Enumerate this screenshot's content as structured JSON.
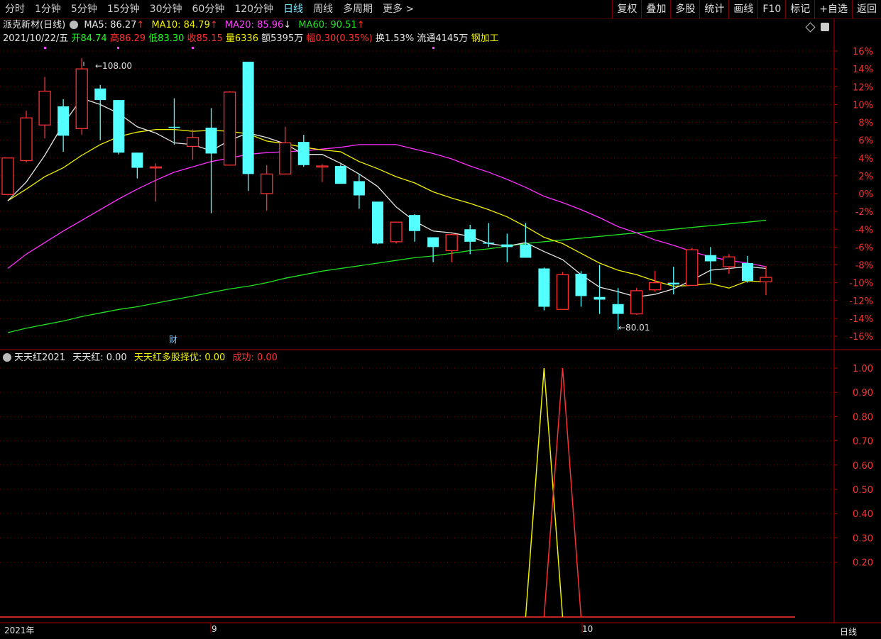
{
  "toolbar": {
    "periods": [
      "分时",
      "1分钟",
      "5分钟",
      "15分钟",
      "30分钟",
      "60分钟",
      "120分钟",
      "日线",
      "周线",
      "多周期",
      "更多 >"
    ],
    "active_period": "日线",
    "buttons": [
      "复权",
      "叠加",
      "多股",
      "统计",
      "画线",
      "F10",
      "标记",
      "+自选",
      "返回"
    ]
  },
  "main_info": {
    "stock_name": "派克新材",
    "period_tag": "(日线)",
    "ma5_label": "MA5: 86.27",
    "ma10_label": "MA10: 84.79",
    "ma20_label": "MA20: 85.96",
    "ma60_label": "MA60: 90.51",
    "date": "2021/10/22/五",
    "open": "开84.74",
    "high": "高86.29",
    "low": "低83.30",
    "close": "收85.15",
    "volume": "量6336",
    "amount": "额5395万",
    "change": "幅0.30(0.35%)",
    "turnover": "换1.53%",
    "float_cap": "流通4145万",
    "industry": "钢加工",
    "high_marker": "108.00",
    "low_marker": "80.01",
    "fin_marker": "财"
  },
  "indicator_info": {
    "name": "天天红2021",
    "line1_label": "天天红: 0.00",
    "line2_label": "天天红多股择优: 0.00",
    "line3_label": "成功: 0.00"
  },
  "x_labels": [
    "2021年",
    "9",
    "10",
    "日线"
  ],
  "colors": {
    "up": "#ff3030",
    "down": "#54ffff",
    "ma5": "#e6e6e6",
    "ma10": "#f0f000",
    "ma20": "#ff30ff",
    "ma60": "#20e020",
    "grid": "#7a0000"
  },
  "chart_data": [
    {
      "type": "candlestick",
      "y_axis": "percent",
      "ylim": [
        -17,
        17
      ],
      "y_ticks": [
        "16%",
        "14%",
        "12%",
        "10%",
        "8%",
        "6%",
        "4%",
        "2%",
        "0%",
        "-2%",
        "-4%",
        "-6%",
        "-8%",
        "-10%",
        "-12%",
        "-14%",
        "-16%"
      ],
      "candles": [
        {
          "o": -0.1,
          "h": 2.9,
          "l": -0.2,
          "c": 4.0,
          "dir": "up"
        },
        {
          "o": 3.7,
          "h": 9.3,
          "l": 3.5,
          "c": 8.5,
          "dir": "up"
        },
        {
          "o": 7.7,
          "h": 13.1,
          "l": 6.2,
          "c": 11.5,
          "dir": "up"
        },
        {
          "o": 9.8,
          "h": 10.6,
          "l": 4.7,
          "c": 6.5,
          "dir": "down"
        },
        {
          "o": 7.3,
          "h": 15.2,
          "l": 6.6,
          "c": 14.0,
          "dir": "up"
        },
        {
          "o": 11.8,
          "h": 12.2,
          "l": 6.0,
          "c": 10.5,
          "dir": "down"
        },
        {
          "o": 10.5,
          "h": 10.5,
          "l": 4.4,
          "c": 4.6,
          "dir": "down"
        },
        {
          "o": 4.6,
          "h": 4.6,
          "l": 1.7,
          "c": 2.9,
          "dir": "down"
        },
        {
          "o": 3.0,
          "h": 3.4,
          "l": -0.9,
          "c": 3.0,
          "dir": "up"
        },
        {
          "o": 7.5,
          "h": 10.7,
          "l": 5.5,
          "c": 7.5,
          "dir": "down"
        },
        {
          "o": 5.3,
          "h": 7.2,
          "l": 3.8,
          "c": 6.3,
          "dir": "up"
        },
        {
          "o": 7.4,
          "h": 9.6,
          "l": -2.2,
          "c": 4.5,
          "dir": "down"
        },
        {
          "o": 3.2,
          "h": 11.5,
          "l": 3.2,
          "c": 11.4,
          "dir": "up"
        },
        {
          "o": 14.8,
          "h": 14.8,
          "l": 0.3,
          "c": 2.2,
          "dir": "down"
        },
        {
          "o": 0.0,
          "h": 3.2,
          "l": -1.9,
          "c": 2.2,
          "dir": "up"
        },
        {
          "o": 2.2,
          "h": 7.5,
          "l": 2.2,
          "c": 5.7,
          "dir": "up"
        },
        {
          "o": 5.8,
          "h": 6.6,
          "l": 3.0,
          "c": 3.2,
          "dir": "down"
        },
        {
          "o": 3.1,
          "h": 3.3,
          "l": 1.3,
          "c": 3.1,
          "dir": "up"
        },
        {
          "o": 3.1,
          "h": 3.3,
          "l": 1.2,
          "c": 1.1,
          "dir": "down"
        },
        {
          "o": 1.4,
          "h": 2.2,
          "l": -1.7,
          "c": -0.2,
          "dir": "down"
        },
        {
          "o": -0.9,
          "h": -0.9,
          "l": -5.7,
          "c": -5.6,
          "dir": "down"
        },
        {
          "o": -5.4,
          "h": -5.2,
          "l": -5.6,
          "c": -3.2,
          "dir": "up"
        },
        {
          "o": -2.4,
          "h": -2.3,
          "l": -5.4,
          "c": -4.2,
          "dir": "down"
        },
        {
          "o": -4.9,
          "h": -4.9,
          "l": -7.7,
          "c": -6.0,
          "dir": "down"
        },
        {
          "o": -6.4,
          "h": -4.5,
          "l": -7.7,
          "c": -4.6,
          "dir": "up"
        },
        {
          "o": -4.0,
          "h": -3.5,
          "l": -6.8,
          "c": -5.4,
          "dir": "down"
        },
        {
          "o": -5.5,
          "h": -3.3,
          "l": -6.0,
          "c": -5.5,
          "dir": "down"
        },
        {
          "o": -5.7,
          "h": -4.5,
          "l": -7.7,
          "c": -6.0,
          "dir": "down"
        },
        {
          "o": -5.7,
          "h": -3.3,
          "l": -7.2,
          "c": -7.2,
          "dir": "down"
        },
        {
          "o": -8.4,
          "h": -8.3,
          "l": -13.1,
          "c": -12.7,
          "dir": "down"
        },
        {
          "o": -13.0,
          "h": -8.8,
          "l": -13.0,
          "c": -9.1,
          "dir": "up"
        },
        {
          "o": -9.0,
          "h": -8.7,
          "l": -12.7,
          "c": -11.5,
          "dir": "down"
        },
        {
          "o": -11.6,
          "h": -8.0,
          "l": -13.5,
          "c": -11.9,
          "dir": "down"
        },
        {
          "o": -12.4,
          "h": -10.6,
          "l": -15.3,
          "c": -13.5,
          "dir": "down"
        },
        {
          "o": -13.5,
          "h": -10.6,
          "l": -13.6,
          "c": -10.9,
          "dir": "up"
        },
        {
          "o": -10.8,
          "h": -8.7,
          "l": -11.0,
          "c": -10.0,
          "dir": "up"
        },
        {
          "o": -10.0,
          "h": -8.2,
          "l": -11.3,
          "c": -10.2,
          "dir": "down"
        },
        {
          "o": -10.3,
          "h": -6.1,
          "l": -10.3,
          "c": -6.3,
          "dir": "up"
        },
        {
          "o": -6.9,
          "h": -6.0,
          "l": -10.0,
          "c": -7.6,
          "dir": "down"
        },
        {
          "o": -8.2,
          "h": -6.8,
          "l": -9.0,
          "c": -7.1,
          "dir": "up"
        },
        {
          "o": -7.8,
          "h": -7.0,
          "l": -10.0,
          "c": -9.8,
          "dir": "down"
        },
        {
          "o": -9.9,
          "h": -8.1,
          "l": -11.4,
          "c": -9.4,
          "dir": "up"
        }
      ],
      "ma5": [
        -0.8,
        1.3,
        4.3,
        7.8,
        10.7,
        10.0,
        9.0,
        7.5,
        6.8,
        5.7,
        5.5,
        4.8,
        6.0,
        6.8,
        6.3,
        5.6,
        4.4,
        4.4,
        3.4,
        2.2,
        0.8,
        -1.5,
        -3.1,
        -4.2,
        -4.4,
        -4.8,
        -5.6,
        -5.9,
        -5.5,
        -6.5,
        -7.4,
        -9.1,
        -10.5,
        -11.0,
        -11.6,
        -11.3,
        -10.7,
        -9.7,
        -8.6,
        -8.4,
        -8.2,
        -8.4
      ],
      "ma10": [
        -0.8,
        0.5,
        1.9,
        2.9,
        4.3,
        5.5,
        6.4,
        6.9,
        7.2,
        7.2,
        7.0,
        7.1,
        7.0,
        6.7,
        5.9,
        5.6,
        5.2,
        4.9,
        4.7,
        3.6,
        2.8,
        1.9,
        1.2,
        0.2,
        -0.5,
        -1.1,
        -1.8,
        -2.6,
        -3.7,
        -4.9,
        -5.6,
        -6.7,
        -7.8,
        -8.6,
        -9.1,
        -9.8,
        -10.4,
        -10.3,
        -10.1,
        -10.6,
        -9.8,
        -9.9
      ],
      "ma20": [
        -8.4,
        -6.8,
        -5.5,
        -4.2,
        -3.0,
        -1.8,
        -0.6,
        0.5,
        1.5,
        2.4,
        3.0,
        3.6,
        4.0,
        4.4,
        4.6,
        4.7,
        4.8,
        5.0,
        5.2,
        5.5,
        5.5,
        5.5,
        5.0,
        4.5,
        3.9,
        3.1,
        2.4,
        1.6,
        0.7,
        -0.3,
        -1.0,
        -1.8,
        -2.7,
        -3.7,
        -4.4,
        -5.2,
        -5.8,
        -6.5,
        -7.1,
        -7.5,
        -7.8,
        -8.2
      ],
      "ma60": [
        -15.6,
        -15.1,
        -14.7,
        -14.3,
        -13.8,
        -13.4,
        -13.0,
        -12.7,
        -12.3,
        -11.9,
        -11.5,
        -11.1,
        -10.7,
        -10.4,
        -10.0,
        -9.5,
        -9.1,
        -8.7,
        -8.4,
        -8.1,
        -7.8,
        -7.5,
        -7.2,
        -7.0,
        -6.7,
        -6.4,
        -6.2,
        -5.9,
        -5.6,
        -5.4,
        -5.2,
        -5.0,
        -4.8,
        -4.6,
        -4.4,
        -4.2,
        -4.0,
        -3.8,
        -3.6,
        -3.4,
        -3.2,
        -3.0
      ]
    },
    {
      "type": "line",
      "ylim": [
        0.0,
        1.05
      ],
      "y_ticks": [
        "1.00",
        "0.90",
        "0.80",
        "0.70",
        "0.60",
        "0.50",
        "0.40",
        "0.30",
        "0.20"
      ],
      "series": [
        {
          "name": "天天红多股择优",
          "color": "#f0f000",
          "spike_index": 29,
          "values": "0 except 1.00 at spike"
        },
        {
          "name": "成功",
          "color": "#ff3030",
          "spike_index": 30,
          "values": "0 except 1.00 at spike"
        }
      ]
    }
  ]
}
